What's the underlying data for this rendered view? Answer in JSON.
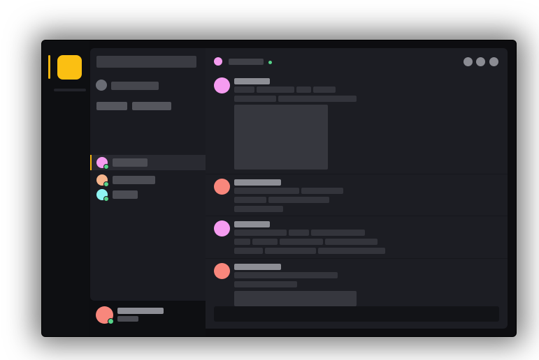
{
  "colors": {
    "accent": "#fbbf12",
    "online": "#57d48a",
    "pink": "#f59cf0",
    "coral": "#f8877c",
    "peach": "#f6b58c",
    "cyan": "#8ff4f2"
  },
  "server": {
    "icon": "server-icon"
  },
  "direct_messages": [
    {
      "avatar_color": "#f59cf0",
      "active": true
    },
    {
      "avatar_color": "#f6b58c",
      "active": false
    },
    {
      "avatar_color": "#8ff4f2",
      "active": false
    }
  ],
  "chat": {
    "header_buttons": [
      "call-icon",
      "video-icon",
      "more-icon"
    ],
    "messages": [
      {
        "avatar_color": "#f59cf0",
        "has_attachment": true
      },
      {
        "avatar_color": "#f8877c",
        "has_attachment": false
      },
      {
        "avatar_color": "#f59cf0",
        "has_attachment": false
      },
      {
        "avatar_color": "#f8877c",
        "has_attachment": true
      }
    ]
  },
  "user": {
    "avatar_color": "#f8877c",
    "status": "online"
  }
}
